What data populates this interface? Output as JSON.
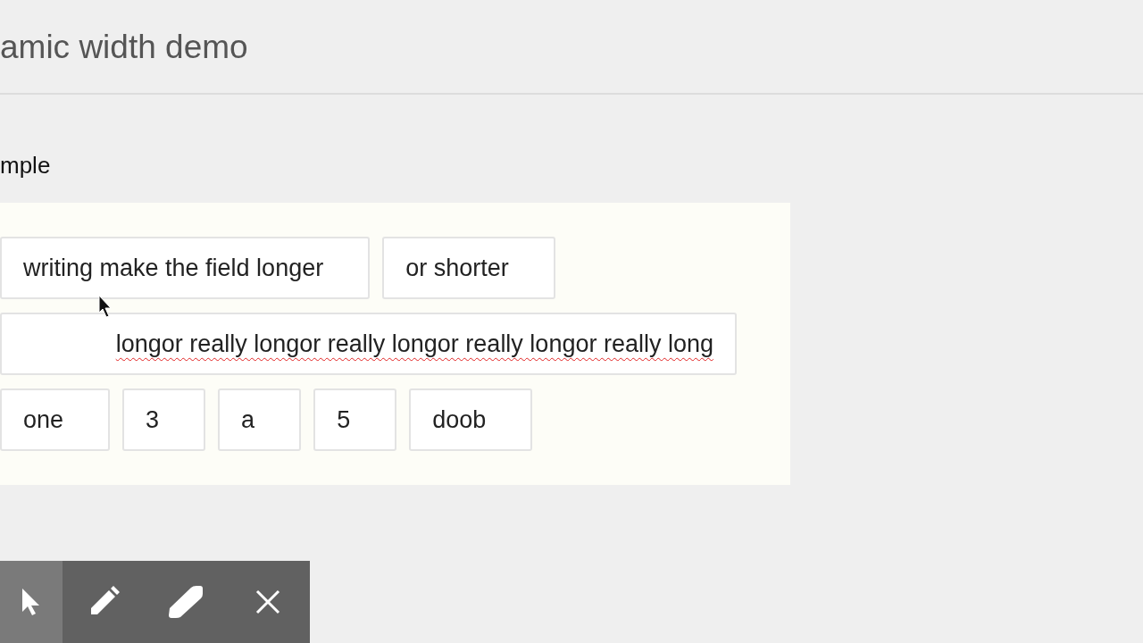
{
  "header": {
    "title": "amic width demo"
  },
  "section": {
    "heading": "mple"
  },
  "rows": [
    {
      "fields": [
        {
          "value": "writing make the field longer",
          "scrolled": false
        },
        {
          "value": "or shorter",
          "scrolled": false
        }
      ]
    },
    {
      "fields": [
        {
          "value": "longor really longor really longor really longor really long",
          "misspelled": true,
          "scrolled": true
        }
      ]
    },
    {
      "fields": [
        {
          "value": "one",
          "scrolled": false
        },
        {
          "value": "3",
          "scrolled": false
        },
        {
          "value": "a",
          "scrolled": false
        },
        {
          "value": "5",
          "scrolled": false
        },
        {
          "value": "doob",
          "scrolled": false
        }
      ]
    }
  ],
  "toolbar": [
    {
      "kind": "pointer",
      "selected": true
    },
    {
      "kind": "pen",
      "selected": false
    },
    {
      "kind": "eraser",
      "selected": false
    },
    {
      "kind": "clear",
      "selected": false
    }
  ]
}
